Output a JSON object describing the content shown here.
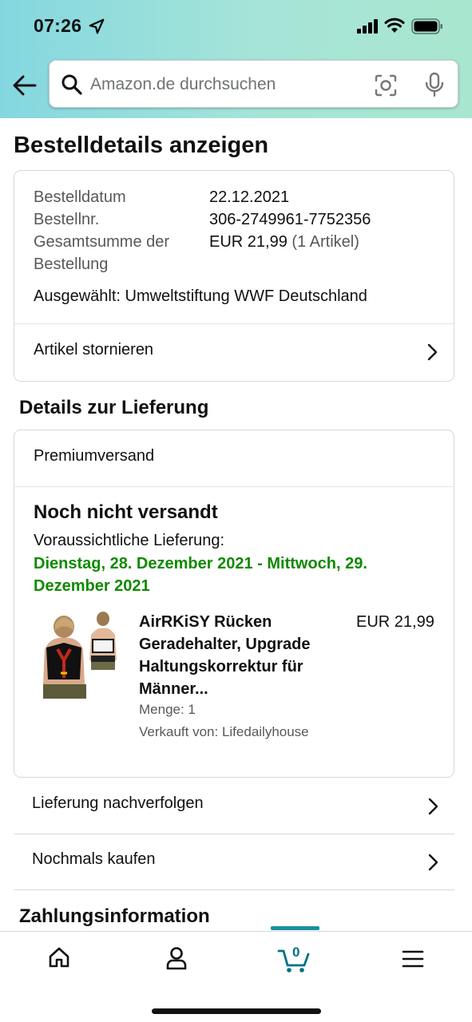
{
  "status_bar": {
    "time": "07:26"
  },
  "search": {
    "placeholder": "Amazon.de durchsuchen"
  },
  "page": {
    "title": "Bestelldetails anzeigen"
  },
  "order": {
    "date_label": "Bestelldatum",
    "date_value": "22.12.2021",
    "number_label": "Bestellnr.",
    "number_value": "306-2749961-7752356",
    "total_label_1": "Gesamtsumme der",
    "total_label_2": "Bestellung",
    "total_value": "EUR 21,99",
    "total_items": "(1 Artikel)",
    "selected_charity": "Ausgewählt: Umweltstiftung WWF Deutschland",
    "cancel_label": "Artikel stornieren"
  },
  "delivery": {
    "section_title": "Details zur Lieferung",
    "method": "Premiumversand",
    "status": "Noch nicht versandt",
    "estimate_label": "Voraussichtliche Lieferung:",
    "estimate_dates": "Dienstag, 28. Dezember 2021 - Mittwoch, 29. Dezember 2021",
    "product": {
      "title": "AirRKiSY Rücken Geradehalter, Upgrade Haltungskorrektur für Männer...",
      "price": "EUR 21,99",
      "quantity": "Menge: 1",
      "seller": "Verkauft von: Lifedailyhouse"
    }
  },
  "actions": {
    "track": "Lieferung nachverfolgen",
    "buy_again": "Nochmals kaufen"
  },
  "payment": {
    "section_title": "Zahlungsinformation"
  },
  "bottom_nav": {
    "cart_count": "0"
  },
  "colors": {
    "accent": "#1a8fa0",
    "delivery_date": "#108a00",
    "header_gradient_start": "#84d7e0",
    "header_gradient_end": "#a9e6cf"
  }
}
